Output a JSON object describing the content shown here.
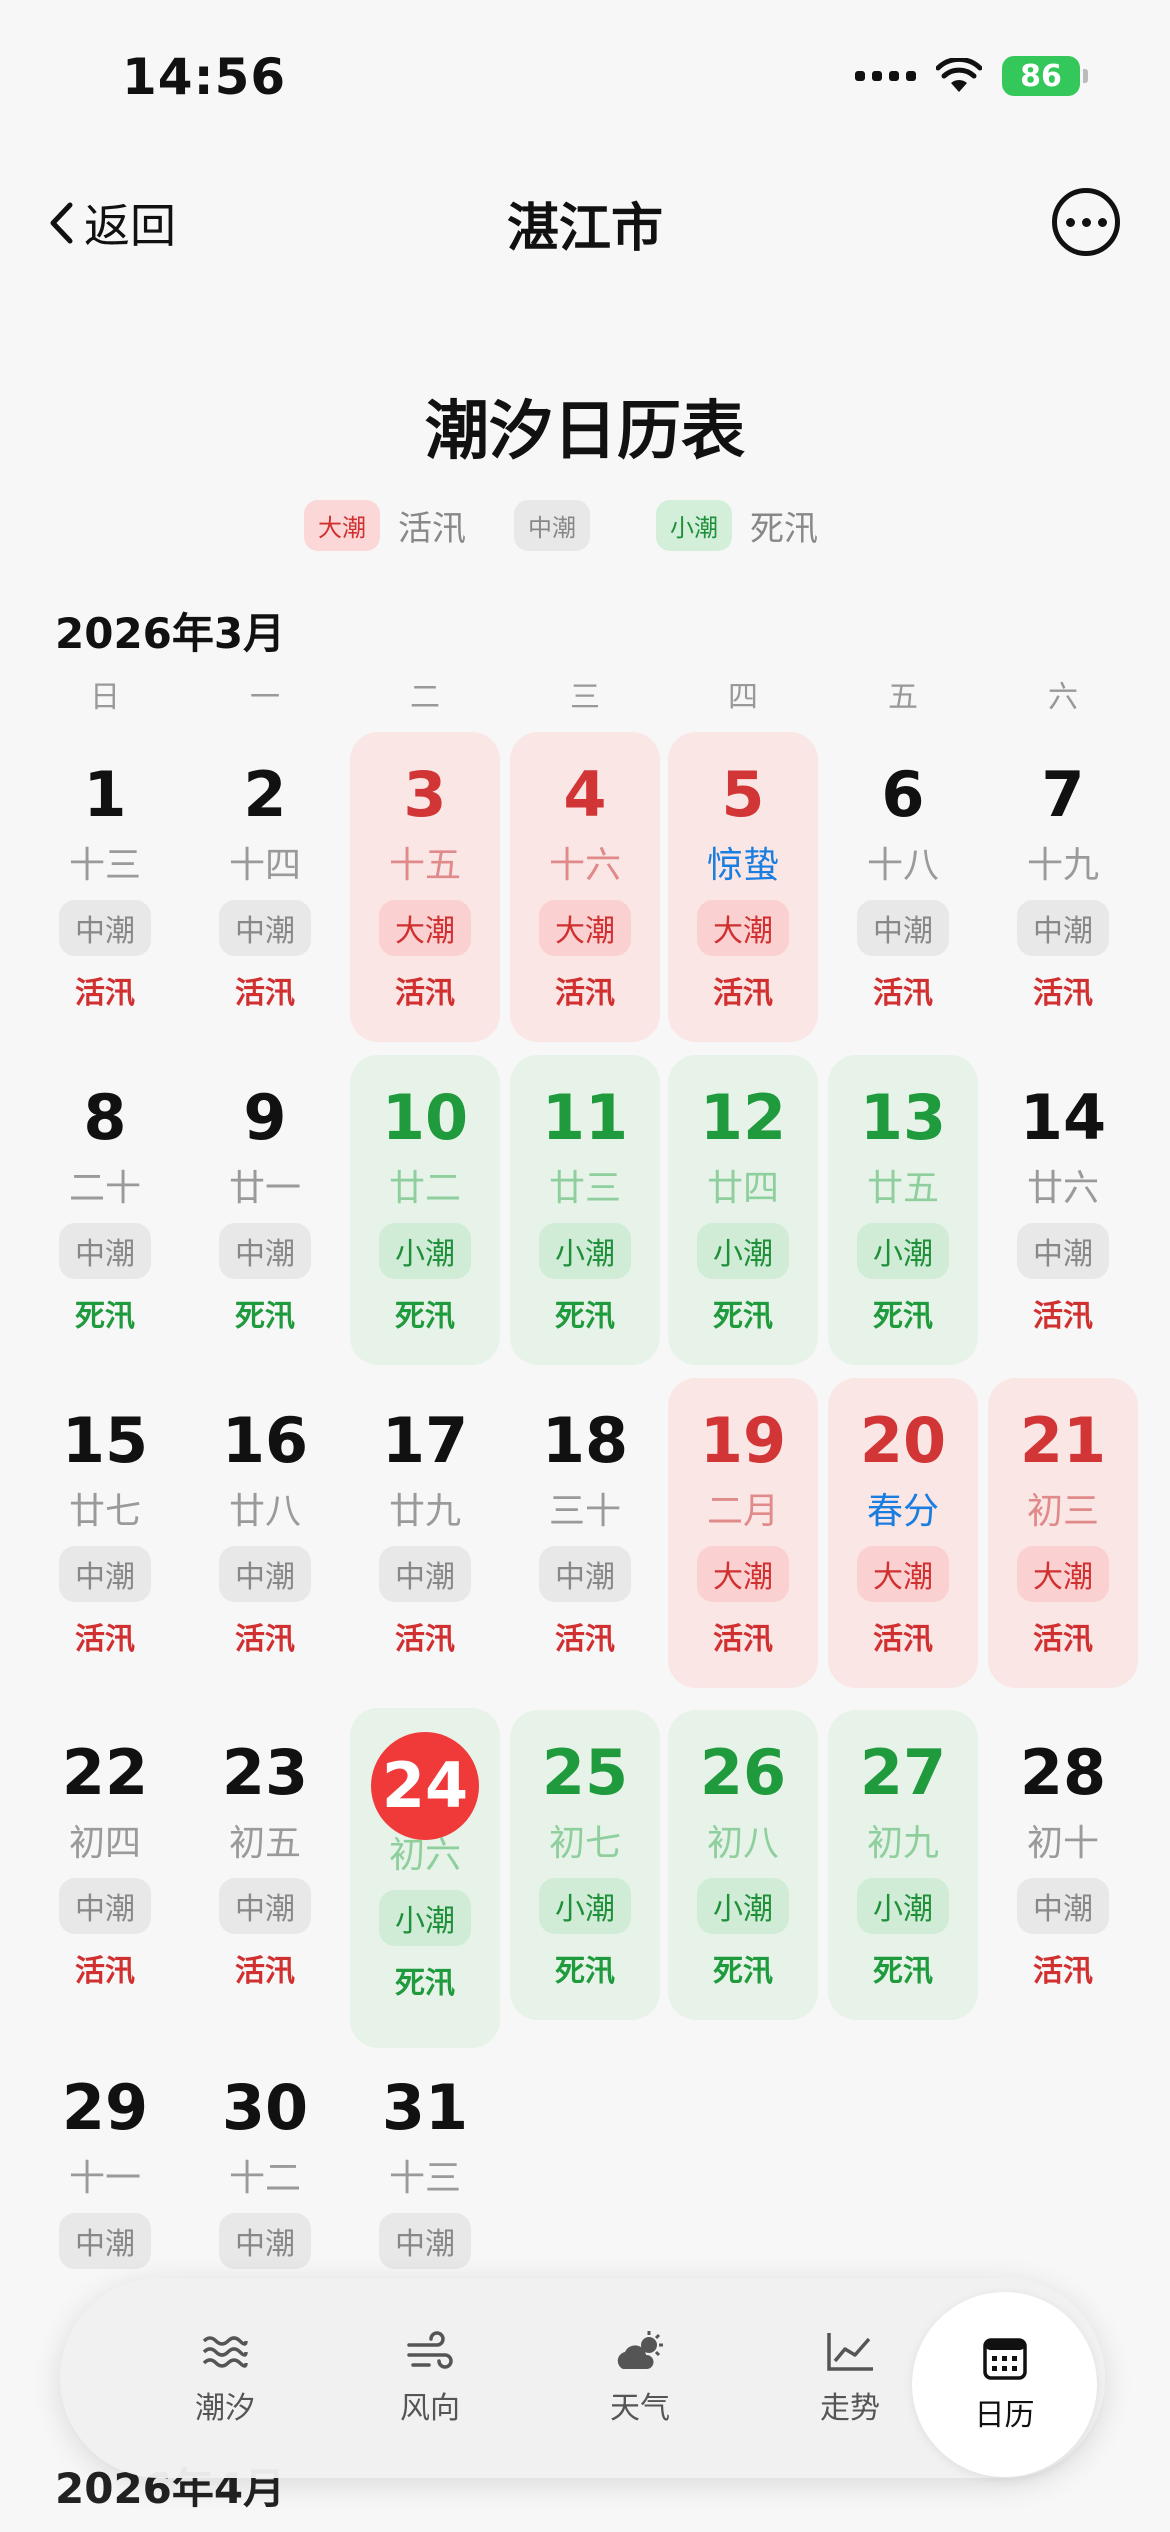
{
  "status": {
    "time": "14:56",
    "battery": "86"
  },
  "nav": {
    "back_label": "返回",
    "title": "湛江市"
  },
  "page_title": "潮汐日历表",
  "legend": [
    {
      "chip": "大潮",
      "text": "活汛",
      "kind": "big"
    },
    {
      "chip": "中潮",
      "text": "",
      "kind": "mid"
    },
    {
      "chip": "小潮",
      "text": "死汛",
      "kind": "small"
    }
  ],
  "month_title": "2026年3月",
  "next_month_title": "2026年4月",
  "weekdays": [
    "日",
    "一",
    "二",
    "三",
    "四",
    "五",
    "六"
  ],
  "days": [
    {
      "day": "1",
      "lunar": "十三",
      "tide": "中潮",
      "flow": "活汛",
      "kind": "mid"
    },
    {
      "day": "2",
      "lunar": "十四",
      "tide": "中潮",
      "flow": "活汛",
      "kind": "mid"
    },
    {
      "day": "3",
      "lunar": "十五",
      "tide": "大潮",
      "flow": "活汛",
      "kind": "big"
    },
    {
      "day": "4",
      "lunar": "十六",
      "tide": "大潮",
      "flow": "活汛",
      "kind": "big"
    },
    {
      "day": "5",
      "lunar": "惊蛰",
      "tide": "大潮",
      "flow": "活汛",
      "kind": "big",
      "term": true
    },
    {
      "day": "6",
      "lunar": "十八",
      "tide": "中潮",
      "flow": "活汛",
      "kind": "mid"
    },
    {
      "day": "7",
      "lunar": "十九",
      "tide": "中潮",
      "flow": "活汛",
      "kind": "mid"
    },
    {
      "day": "8",
      "lunar": "二十",
      "tide": "中潮",
      "flow": "死汛",
      "kind": "mid",
      "dead": true
    },
    {
      "day": "9",
      "lunar": "廿一",
      "tide": "中潮",
      "flow": "死汛",
      "kind": "mid",
      "dead": true
    },
    {
      "day": "10",
      "lunar": "廿二",
      "tide": "小潮",
      "flow": "死汛",
      "kind": "small"
    },
    {
      "day": "11",
      "lunar": "廿三",
      "tide": "小潮",
      "flow": "死汛",
      "kind": "small"
    },
    {
      "day": "12",
      "lunar": "廿四",
      "tide": "小潮",
      "flow": "死汛",
      "kind": "small"
    },
    {
      "day": "13",
      "lunar": "廿五",
      "tide": "小潮",
      "flow": "死汛",
      "kind": "small"
    },
    {
      "day": "14",
      "lunar": "廿六",
      "tide": "中潮",
      "flow": "活汛",
      "kind": "mid"
    },
    {
      "day": "15",
      "lunar": "廿七",
      "tide": "中潮",
      "flow": "活汛",
      "kind": "mid"
    },
    {
      "day": "16",
      "lunar": "廿八",
      "tide": "中潮",
      "flow": "活汛",
      "kind": "mid"
    },
    {
      "day": "17",
      "lunar": "廿九",
      "tide": "中潮",
      "flow": "活汛",
      "kind": "mid"
    },
    {
      "day": "18",
      "lunar": "三十",
      "tide": "中潮",
      "flow": "活汛",
      "kind": "mid"
    },
    {
      "day": "19",
      "lunar": "二月",
      "tide": "大潮",
      "flow": "活汛",
      "kind": "big"
    },
    {
      "day": "20",
      "lunar": "春分",
      "tide": "大潮",
      "flow": "活汛",
      "kind": "big",
      "term": true
    },
    {
      "day": "21",
      "lunar": "初三",
      "tide": "大潮",
      "flow": "活汛",
      "kind": "big"
    },
    {
      "day": "22",
      "lunar": "初四",
      "tide": "中潮",
      "flow": "活汛",
      "kind": "mid"
    },
    {
      "day": "23",
      "lunar": "初五",
      "tide": "中潮",
      "flow": "活汛",
      "kind": "mid"
    },
    {
      "day": "24",
      "lunar": "初六",
      "tide": "小潮",
      "flow": "死汛",
      "kind": "small",
      "today": true
    },
    {
      "day": "25",
      "lunar": "初七",
      "tide": "小潮",
      "flow": "死汛",
      "kind": "small"
    },
    {
      "day": "26",
      "lunar": "初八",
      "tide": "小潮",
      "flow": "死汛",
      "kind": "small"
    },
    {
      "day": "27",
      "lunar": "初九",
      "tide": "小潮",
      "flow": "死汛",
      "kind": "small"
    },
    {
      "day": "28",
      "lunar": "初十",
      "tide": "中潮",
      "flow": "活汛",
      "kind": "mid"
    },
    {
      "day": "29",
      "lunar": "十一",
      "tide": "中潮",
      "flow": "",
      "kind": "mid"
    },
    {
      "day": "30",
      "lunar": "十二",
      "tide": "中潮",
      "flow": "",
      "kind": "mid"
    },
    {
      "day": "31",
      "lunar": "十三",
      "tide": "中潮",
      "flow": "",
      "kind": "mid"
    }
  ],
  "tabs": [
    {
      "label": "潮汐",
      "icon": "waves-icon",
      "active": false
    },
    {
      "label": "风向",
      "icon": "wind-icon",
      "active": false
    },
    {
      "label": "天气",
      "icon": "cloud-sun-icon",
      "active": false
    },
    {
      "label": "走势",
      "icon": "chart-line-icon",
      "active": false
    },
    {
      "label": "日历",
      "icon": "calendar-icon",
      "active": true
    }
  ],
  "colors": {
    "big": "#d03030",
    "small": "#1f9a3c",
    "term": "#1a7ee0",
    "today": "#f03a3a",
    "battery": "#34c759"
  }
}
